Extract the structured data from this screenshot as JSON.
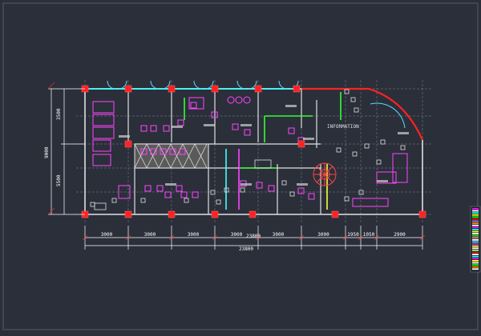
{
  "colors": {
    "background": "#2b2f3a",
    "grid": "#c8c8c8",
    "wall": "#e0e0e0",
    "column": "#ff2222",
    "furniture": "#ff44ff",
    "dimension": "#ffffff",
    "door": "#55ddff",
    "glass": "#44ffff",
    "stair": "#ff4444",
    "accent_green": "#33ff33",
    "accent_yellow": "#ffff33"
  },
  "vertical_dims": {
    "top": "3500",
    "middle": "9000",
    "bottom": "5500"
  },
  "horizontal_dims": {
    "segments": [
      "3000",
      "3000",
      "3000",
      "3000",
      "3000",
      "3000",
      "1950",
      "1050",
      "2900"
    ],
    "overlap_label": "23800",
    "total": "23800"
  },
  "room_labels": {
    "information": "INFORMATION"
  },
  "palette_panel": {
    "swatches": [
      "#ff00ff",
      "#ffffff",
      "#00ffff",
      "#ffff00",
      "#00ff00",
      "#ff0000",
      "#8080ff",
      "#ff8000",
      "#ffffff",
      "#ff00ff",
      "#00ffff",
      "#ffff00",
      "#ffffff",
      "#00ff00",
      "#ff8080",
      "#ffffff",
      "#00ffff",
      "#ff00ff",
      "#ffff00",
      "#ffffff",
      "#80ff80",
      "#ff0000",
      "#ffffff",
      "#00ffff",
      "#ff00ff",
      "#ffff00",
      "#ffffff",
      "#00ff00",
      "#ff8000",
      "#ffffff"
    ]
  }
}
